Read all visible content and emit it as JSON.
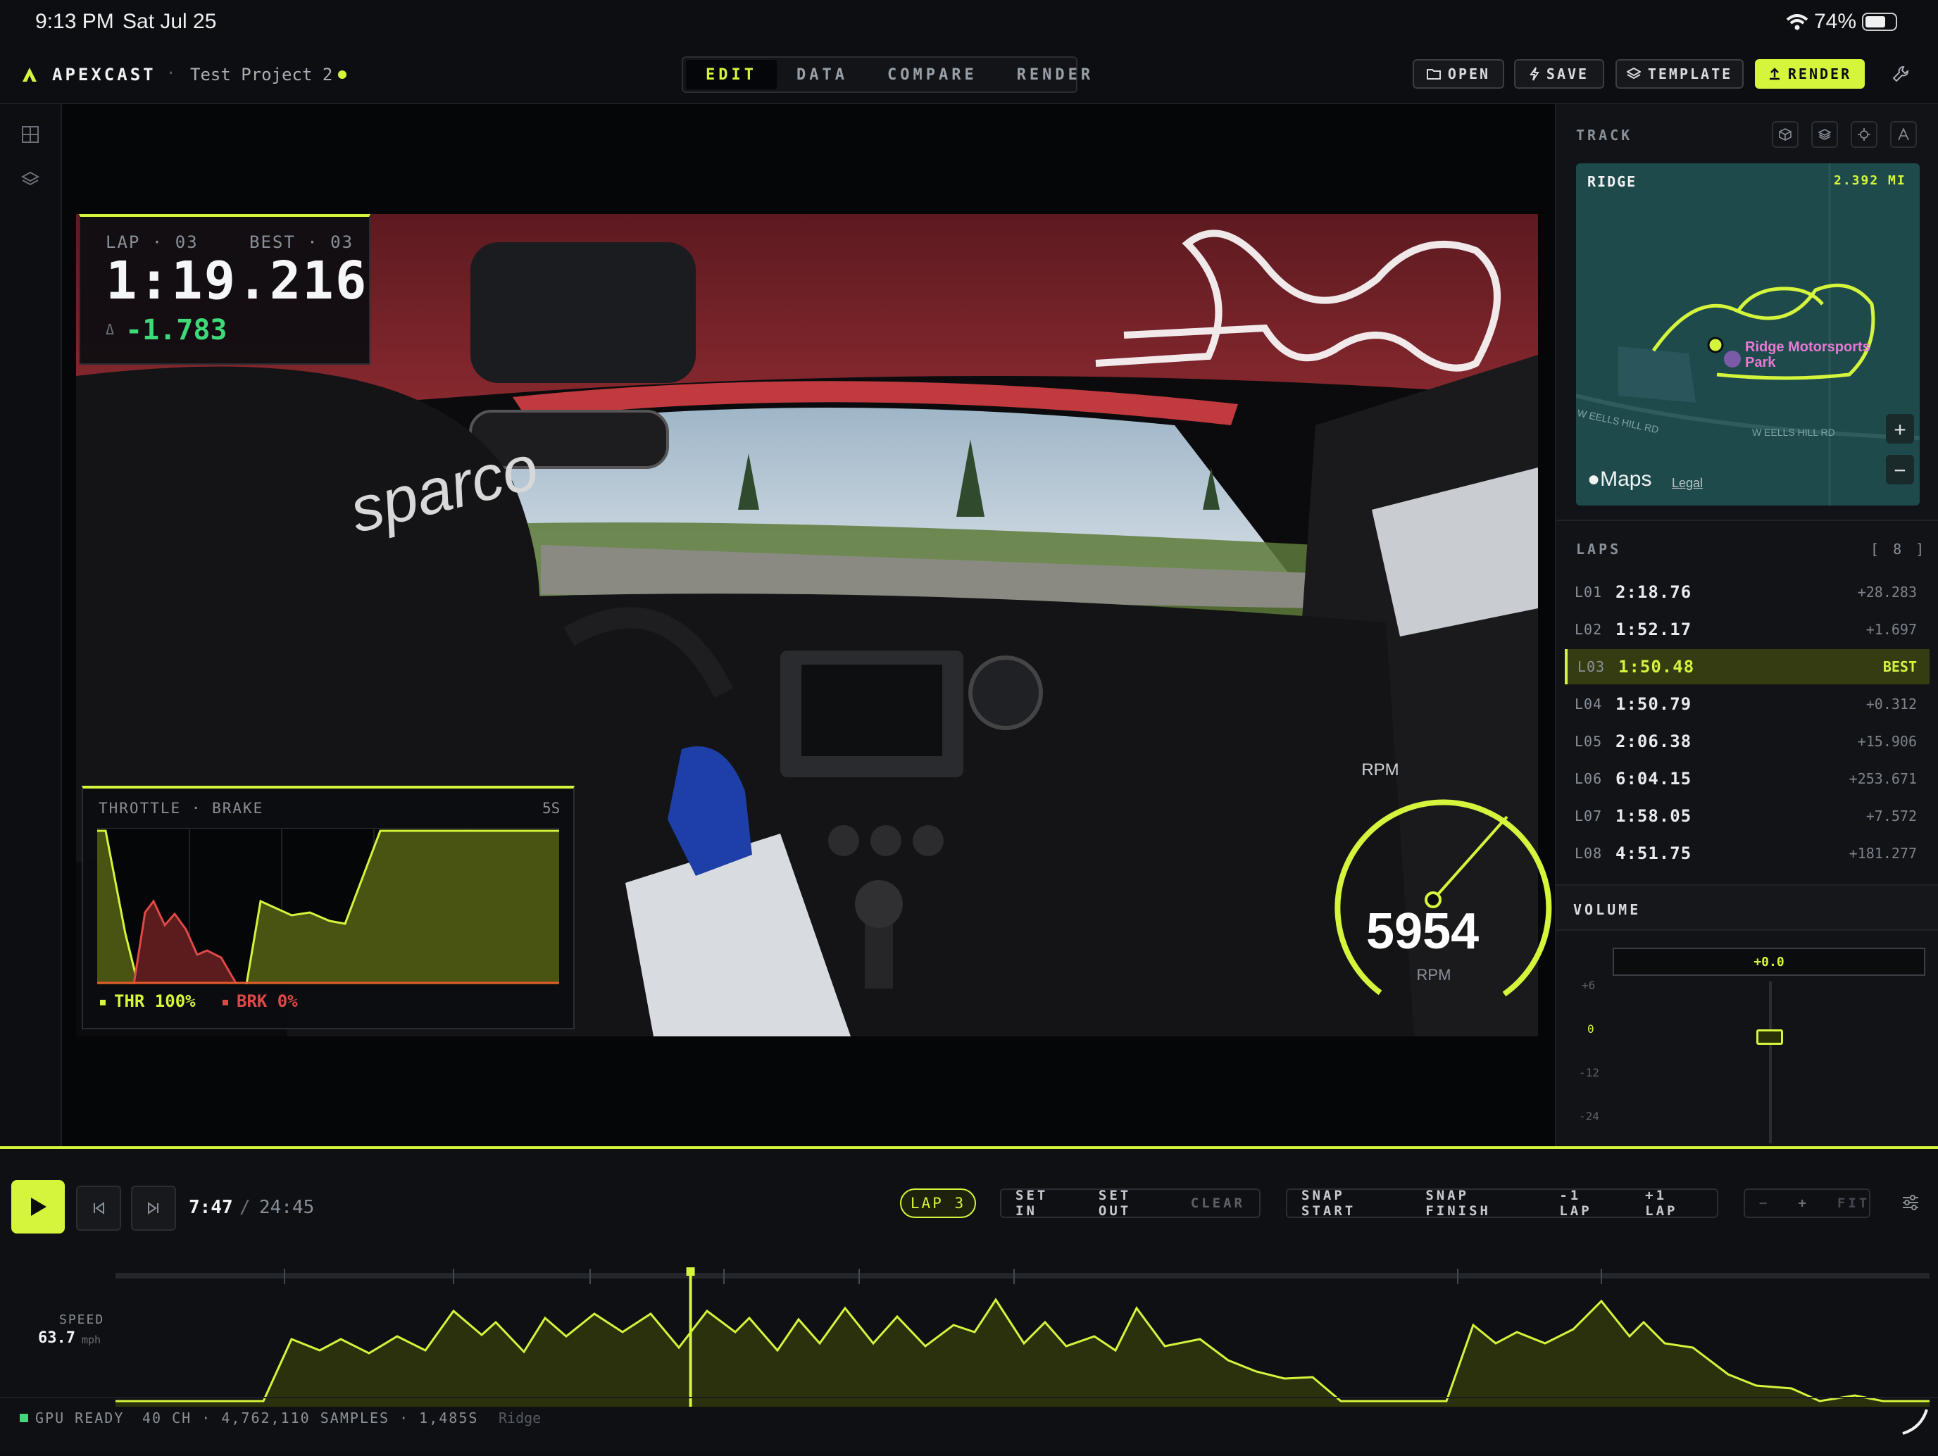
{
  "status_bar": {
    "time": "9:13 PM",
    "date": "Sat Jul 25",
    "battery": "74%"
  },
  "app": {
    "name": "APEXCAST",
    "project": "Test Project 2"
  },
  "tabs": [
    "EDIT",
    "DATA",
    "COMPARE",
    "RENDER"
  ],
  "active_tab": "EDIT",
  "toolbar": {
    "open": "OPEN",
    "save": "SAVE",
    "template": "TEMPLATE",
    "render": "RENDER"
  },
  "overlay_lap": {
    "lap_label": "LAP · 03",
    "best_label": "BEST · 03",
    "time": "1:19.216",
    "delta_symbol": "Δ",
    "delta": "-1.783"
  },
  "overlay_throttle": {
    "title": "THROTTLE · BRAKE",
    "window": "5S",
    "y_top": "100",
    "y_bottom": "0",
    "thr": "THR 100%",
    "brk": "BRK 0%"
  },
  "overlay_rpm": {
    "label": "RPM",
    "value": "5954",
    "unit": "RPM",
    "gauge_fraction": 0.78
  },
  "track": {
    "section": "TRACK",
    "name": "RIDGE",
    "length": "2.392 MI",
    "poi": "Ridge Motorsports Park",
    "road_1": "W EELLS HILL RD",
    "road_2": "W EELLS HILL RD",
    "maps": "Maps",
    "legal": "Legal",
    "zoom_in": "+",
    "zoom_out": "−"
  },
  "laps": {
    "title": "LAPS",
    "count": "[ 8 ]",
    "rows": [
      {
        "id": "L01",
        "time": "2:18.76",
        "delta": "+28.283"
      },
      {
        "id": "L02",
        "time": "1:52.17",
        "delta": "+1.697"
      },
      {
        "id": "L03",
        "time": "1:50.48",
        "delta": "BEST"
      },
      {
        "id": "L04",
        "time": "1:50.79",
        "delta": "+0.312"
      },
      {
        "id": "L05",
        "time": "2:06.38",
        "delta": "+15.906"
      },
      {
        "id": "L06",
        "time": "6:04.15",
        "delta": "+253.671"
      },
      {
        "id": "L07",
        "time": "1:58.05",
        "delta": "+7.572"
      },
      {
        "id": "L08",
        "time": "4:51.75",
        "delta": "+181.277"
      }
    ],
    "selected_index": 2
  },
  "volume": {
    "title": "VOLUME",
    "value": "+0.0",
    "ticks": [
      "+6",
      "0",
      "-12",
      "-24"
    ]
  },
  "transport": {
    "current": "7:47",
    "separator": "/",
    "total": "24:45"
  },
  "timeline_controls": {
    "lap_chip": "LAP 3",
    "set_in": "SET IN",
    "set_out": "SET OUT",
    "clear": "CLEAR",
    "snap_start": "SNAP START",
    "snap_finish": "SNAP FINISH",
    "minus_lap": "-1 LAP",
    "plus_lap": "+1 LAP",
    "zoom_minus": "−",
    "zoom_plus": "+",
    "fit": "FIT"
  },
  "speed": {
    "label": "SPEED",
    "value": "63.7",
    "unit": "mph",
    "playhead_fraction": 0.317
  },
  "footer": {
    "gpu": "GPU READY",
    "stats": "40 CH · 4,762,110 SAMPLES · 1,485S",
    "track": "Ridge"
  }
}
